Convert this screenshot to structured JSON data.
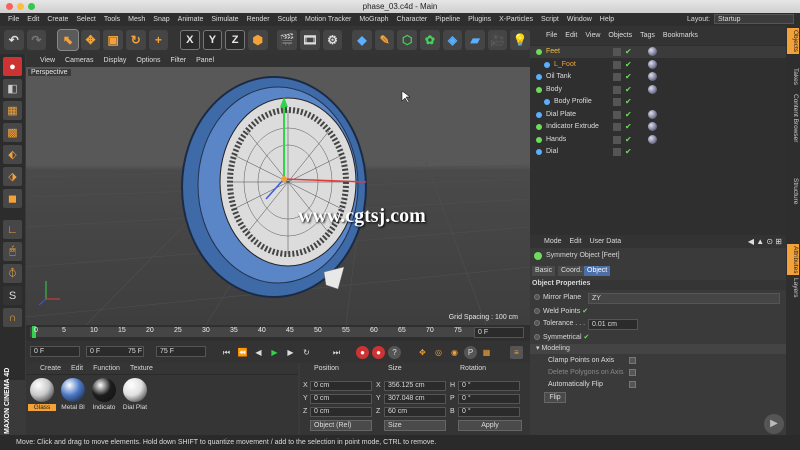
{
  "window": {
    "title": "phase_03.c4d - Main"
  },
  "menu": {
    "items": [
      "File",
      "Edit",
      "Create",
      "Select",
      "Tools",
      "Mesh",
      "Snap",
      "Animate",
      "Simulate",
      "Render",
      "Sculpt",
      "Motion Tracker",
      "MoGraph",
      "Character",
      "Pipeline",
      "Plugins",
      "X-Particles",
      "Script",
      "Window",
      "Help"
    ],
    "layout_label": "Layout:",
    "layout_value": "Startup"
  },
  "toolbar": {
    "axes": [
      "X",
      "Y",
      "Z"
    ]
  },
  "viewport": {
    "menu": [
      "View",
      "Cameras",
      "Display",
      "Options",
      "Filter",
      "Panel"
    ],
    "label": "Perspective",
    "grid_spacing": "Grid Spacing : 100 cm",
    "watermark": "www.cgtsj.com"
  },
  "timeline": {
    "ticks": [
      "0",
      "5",
      "10",
      "15",
      "20",
      "25",
      "30",
      "35",
      "40",
      "45",
      "50",
      "55",
      "60",
      "65",
      "70",
      "75"
    ],
    "end_label": "0 F"
  },
  "transport": {
    "start_frame": "0 F",
    "current_frame": "0 F",
    "range_end": "75 F",
    "end_frame": "75 F"
  },
  "materials": {
    "menu": [
      "Create",
      "Edit",
      "Function",
      "Texture"
    ],
    "items": [
      {
        "label": "Glass",
        "color": "#c9c9c9",
        "selected": true
      },
      {
        "label": "Metal Bl",
        "color": "#4a78c8",
        "selected": false
      },
      {
        "label": "Indicato",
        "color": "#1d1d1d",
        "selected": false
      },
      {
        "label": "Dial Plat",
        "color": "#e0e0e0",
        "selected": false
      }
    ]
  },
  "coords": {
    "headers": [
      "Position",
      "Size",
      "Rotation"
    ],
    "rows": [
      {
        "axis": "X",
        "pos": "0 cm",
        "size_axis": "X",
        "size": "356.125 cm",
        "rot_axis": "H",
        "rot": "0 °"
      },
      {
        "axis": "Y",
        "pos": "0 cm",
        "size_axis": "Y",
        "size": "307.048 cm",
        "rot_axis": "P",
        "rot": "0 °"
      },
      {
        "axis": "Z",
        "pos": "0 cm",
        "size_axis": "Z",
        "size": "60 cm",
        "rot_axis": "B",
        "rot": "0 °"
      }
    ],
    "mode": "Object (Rel)",
    "size_mode": "Size",
    "apply": "Apply"
  },
  "objects": {
    "menu": [
      "File",
      "Edit",
      "View",
      "Objects",
      "Tags",
      "Bookmarks"
    ],
    "items": [
      {
        "name": "Feet",
        "color": "#6ddc5a",
        "text_color": "#f3c13a",
        "indent": 0
      },
      {
        "name": "L_Foot",
        "color": "#5ab0ff",
        "text_color": "#f3a23a",
        "indent": 1
      },
      {
        "name": "Oil Tank",
        "color": "#5ab0ff",
        "text_color": "#dddddd",
        "indent": 0
      },
      {
        "name": "Body",
        "color": "#6ddc5a",
        "text_color": "#dddddd",
        "indent": 0
      },
      {
        "name": "Body Profile",
        "color": "#5ab0ff",
        "text_color": "#dddddd",
        "indent": 1
      },
      {
        "name": "Dial Plate",
        "color": "#5ab0ff",
        "text_color": "#dddddd",
        "indent": 0
      },
      {
        "name": "Indicator Extrude",
        "color": "#6ddc5a",
        "text_color": "#dddddd",
        "indent": 0
      },
      {
        "name": "Hands",
        "color": "#6ddc5a",
        "text_color": "#dddddd",
        "indent": 0
      },
      {
        "name": "Dial",
        "color": "#5ab0ff",
        "text_color": "#dddddd",
        "indent": 0
      }
    ]
  },
  "attributes": {
    "menu": [
      "Mode",
      "Edit",
      "User Data"
    ],
    "title": "Symmetry Object [Feet]",
    "tabs": [
      "Basic",
      "Coord.",
      "Object"
    ],
    "section": "Object Properties",
    "mirror_plane_label": "Mirror Plane",
    "mirror_plane_value": "ZY",
    "weld_label": "Weld Points",
    "tolerance_label": "Tolerance",
    "tolerance_value": "0.01 cm",
    "symmetrical_label": "Symmetrical",
    "modeling_label": "Modeling",
    "clamp_label": "Clamp Points on Axis",
    "delete_label": "Delete Polygons on Axis",
    "autoflip_label": "Automatically Flip",
    "flip_button": "Flip"
  },
  "right_tabs": [
    "Objects",
    "Takes",
    "Content Browser",
    "Structure",
    "Attributes",
    "Layers"
  ],
  "status": "Move: Click and drag to move elements. Hold down SHIFT to quantize movement / add to the selection in point mode, CTRL to remove.",
  "brand": "MAXON CINEMA 4D"
}
